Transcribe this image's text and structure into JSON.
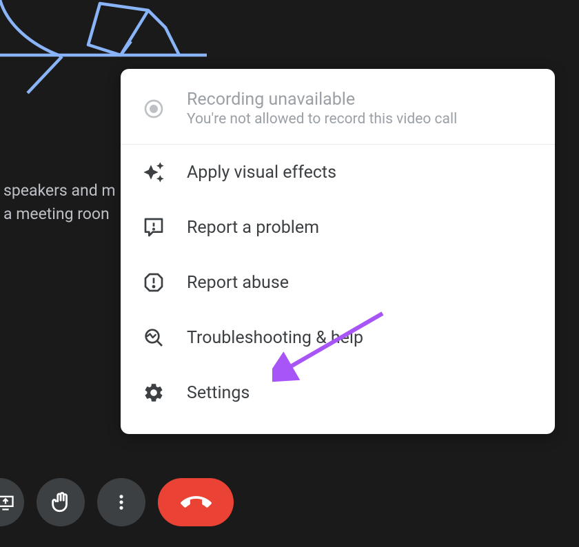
{
  "background": {
    "text_line1": "speakers and m",
    "text_line2": "a meeting roon"
  },
  "menu": {
    "header": {
      "title": "Recording unavailable",
      "subtitle": "You're not allowed to record this video call"
    },
    "items": [
      {
        "label": "Apply visual effects",
        "icon": "sparkle"
      },
      {
        "label": "Report a problem",
        "icon": "feedback"
      },
      {
        "label": "Report abuse",
        "icon": "abuse"
      },
      {
        "label": "Troubleshooting & help",
        "icon": "troubleshoot"
      },
      {
        "label": "Settings",
        "icon": "gear"
      }
    ]
  },
  "toolbar": {
    "present": "Present",
    "raise_hand": "Raise hand",
    "more": "More options",
    "end_call": "Leave call"
  }
}
